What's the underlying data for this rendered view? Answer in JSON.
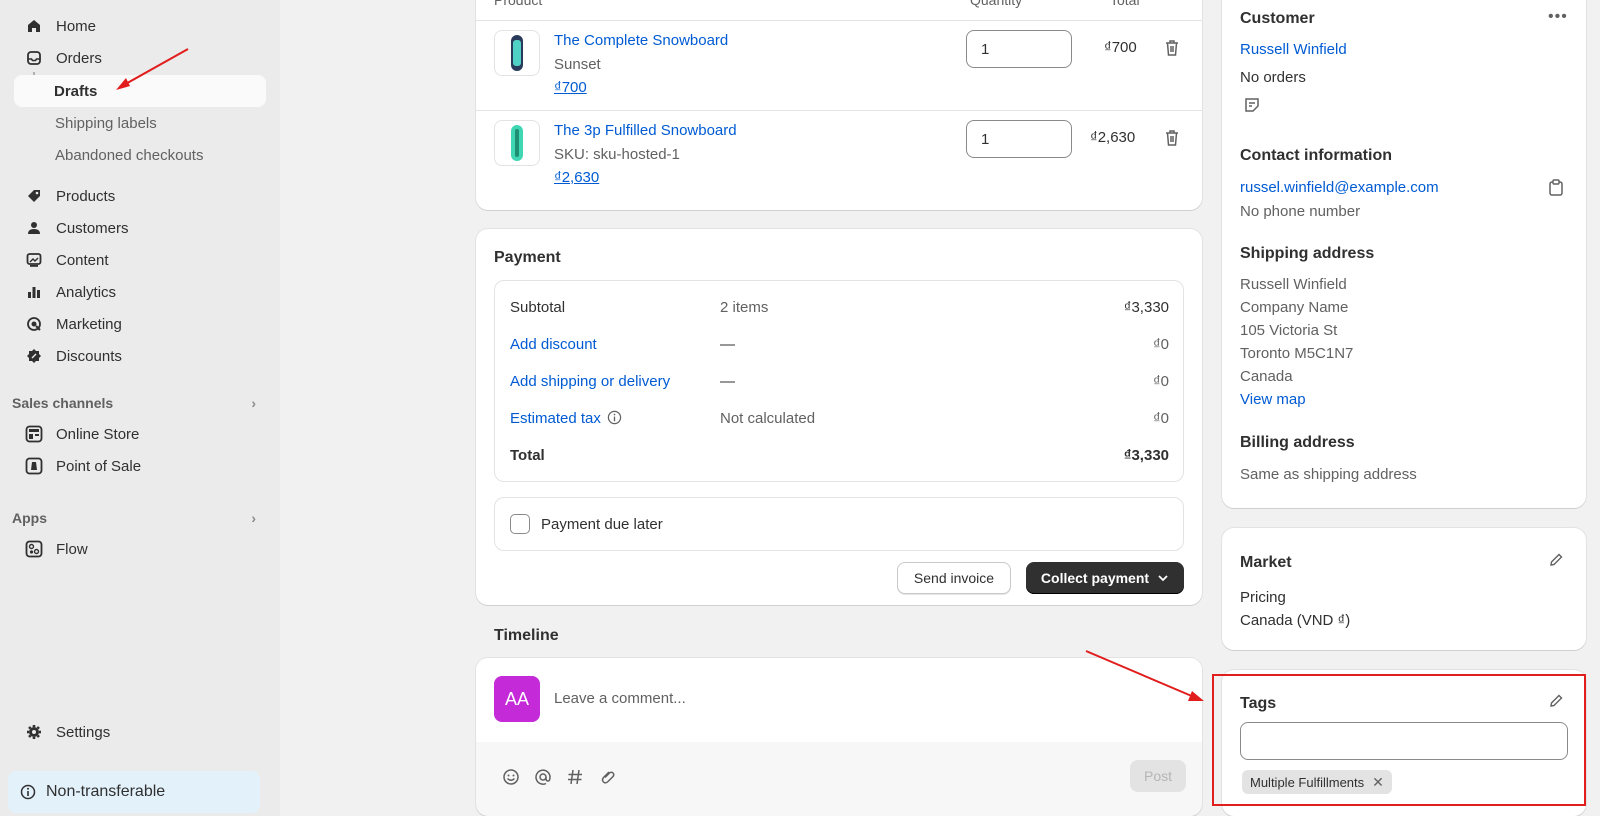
{
  "sidebar": {
    "items": [
      {
        "label": "Home",
        "icon": "home-icon"
      },
      {
        "label": "Orders",
        "icon": "orders-icon"
      },
      {
        "label": "Drafts"
      },
      {
        "label": "Shipping labels"
      },
      {
        "label": "Abandoned checkouts"
      },
      {
        "label": "Products",
        "icon": "tag-icon"
      },
      {
        "label": "Customers",
        "icon": "person-icon"
      },
      {
        "label": "Content",
        "icon": "content-icon"
      },
      {
        "label": "Analytics",
        "icon": "bar-chart-icon"
      },
      {
        "label": "Marketing",
        "icon": "target-icon"
      },
      {
        "label": "Discounts",
        "icon": "discount-icon"
      }
    ],
    "sales_channels": {
      "title": "Sales channels",
      "items": [
        {
          "label": "Online Store"
        },
        {
          "label": "Point of Sale"
        }
      ]
    },
    "apps": {
      "title": "Apps",
      "items": [
        {
          "label": "Flow"
        }
      ]
    },
    "settings": "Settings",
    "store_badge": "Non-transferable"
  },
  "products": {
    "header": {
      "product": "Product",
      "quantity": "Quantity",
      "total": "Total"
    },
    "items": [
      {
        "name": "The Complete Snowboard",
        "variant": "Sunset",
        "price": "₫700",
        "qty": "1",
        "total": "₫700"
      },
      {
        "name": "The 3p Fulfilled Snowboard",
        "variant": "SKU: sku-hosted-1",
        "price": "₫2,630",
        "qty": "1",
        "total": "₫2,630"
      }
    ]
  },
  "payment": {
    "title": "Payment",
    "subtotal": {
      "label": "Subtotal",
      "detail": "2 items",
      "value": "₫3,330"
    },
    "discount": {
      "label": "Add discount",
      "detail": "—",
      "value": "₫0"
    },
    "shipping": {
      "label": "Add shipping or delivery",
      "detail": "—",
      "value": "₫0"
    },
    "tax": {
      "label": "Estimated tax",
      "detail": "Not calculated",
      "value": "₫0"
    },
    "total": {
      "label": "Total",
      "value": "₫3,330"
    },
    "due_later": "Payment due later",
    "send_invoice": "Send invoice",
    "collect_payment": "Collect payment"
  },
  "timeline": {
    "title": "Timeline",
    "avatar": "AA",
    "placeholder": "Leave a comment...",
    "post": "Post"
  },
  "customer": {
    "title": "Customer",
    "name": "Russell Winfield",
    "orders": "No orders",
    "contact_title": "Contact information",
    "email": "russel.winfield@example.com",
    "phone": "No phone number",
    "shipping_title": "Shipping address",
    "address": [
      "Russell Winfield",
      "Company Name",
      "105 Victoria St",
      "Toronto M5C1N7",
      "Canada"
    ],
    "view_map": "View map",
    "billing_title": "Billing address",
    "billing": "Same as shipping address"
  },
  "market": {
    "title": "Market",
    "pricing_label": "Pricing",
    "pricing_value": "Canada (VND ₫)"
  },
  "tags": {
    "title": "Tags",
    "input_value": "",
    "chip": "Multiple Fulfillments"
  },
  "colors": {
    "link": "#005bd3",
    "annotation": "#e11d1d",
    "avatar": "#c42ad8",
    "primary": "#303030"
  }
}
